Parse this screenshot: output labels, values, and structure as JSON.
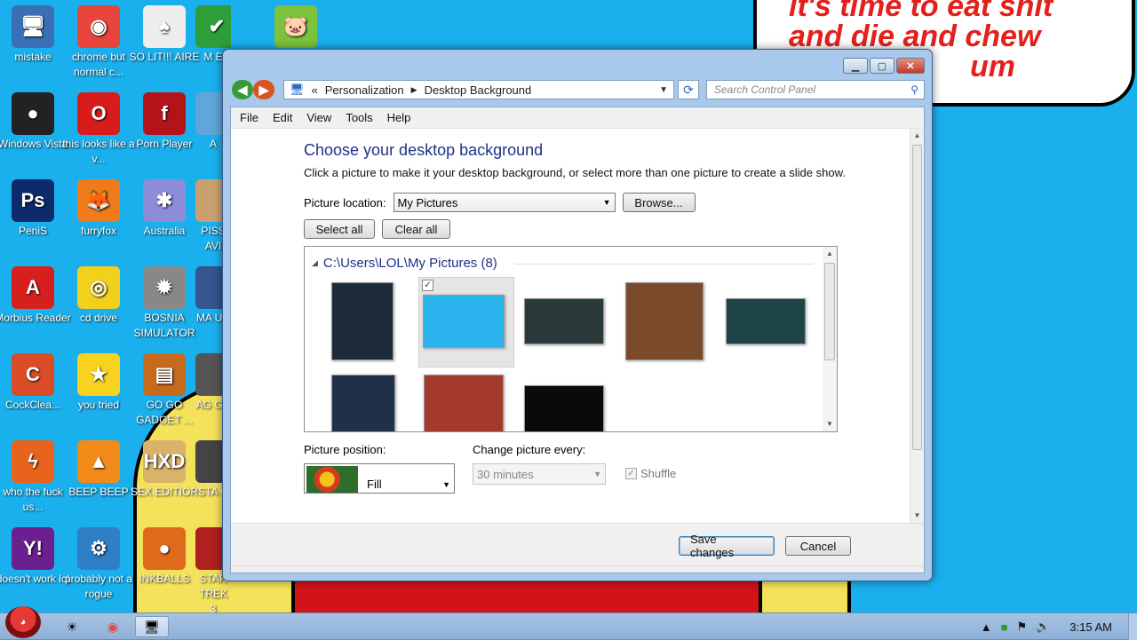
{
  "wallpaper": {
    "bubble_lines": [
      "it's time to eat shit",
      "and die and chew",
      "um"
    ]
  },
  "desktop_icons": [
    {
      "label": "mistake",
      "glyph": "🖥",
      "color": "#3b6fb5"
    },
    {
      "label": "chrome but normal c...",
      "glyph": "◉",
      "color": "#e8453c"
    },
    {
      "label": "SO LIT!!! AIRE",
      "glyph": "♠",
      "color": "#eeeeee"
    },
    {
      "label": "M E",
      "glyph": "✔",
      "color": "#2e9e3a"
    },
    {
      "label": "",
      "glyph": "🐷",
      "color": "#7cc23d"
    },
    {
      "label": "Windows Vista",
      "glyph": "●",
      "color": "#222222"
    },
    {
      "label": "this looks like a v...",
      "glyph": "O",
      "color": "#d81c1c"
    },
    {
      "label": "Porn Player",
      "glyph": "f",
      "color": "#b3141a"
    },
    {
      "label": "A",
      "glyph": "",
      "color": "#5fa6d9"
    },
    {
      "label": "PeniS",
      "glyph": "Ps",
      "color": "#0b2b6b"
    },
    {
      "label": "furryfox",
      "glyph": "🦊",
      "color": "#f07b1a"
    },
    {
      "label": "Australia",
      "glyph": "✱",
      "color": "#8c8cd8"
    },
    {
      "label": "PISS AVI",
      "glyph": "",
      "color": "#c9a070"
    },
    {
      "label": "Morbius Reader",
      "glyph": "A",
      "color": "#d6201d"
    },
    {
      "label": "cd drive",
      "glyph": "◎",
      "color": "#f2d11c"
    },
    {
      "label": "BOSNIA SIMULATOR",
      "glyph": "✹",
      "color": "#888888"
    },
    {
      "label": "MA UN",
      "glyph": "",
      "color": "#34558f"
    },
    {
      "label": "CockClea...",
      "glyph": "C",
      "color": "#d94c26"
    },
    {
      "label": "you tried",
      "glyph": "★",
      "color": "#f7d21e"
    },
    {
      "label": "GO GO GADGET ...",
      "glyph": "▤",
      "color": "#c66a1c"
    },
    {
      "label": "AG GH",
      "glyph": "",
      "color": "#555555"
    },
    {
      "label": "who the fuck us...",
      "glyph": "ϟ",
      "color": "#e8641c"
    },
    {
      "label": "BEEP BEEP",
      "glyph": "▲",
      "color": "#f28a1a"
    },
    {
      "label": "SEX EDITIOR",
      "glyph": "HXD",
      "color": "#d9b36a"
    },
    {
      "label": "STA C",
      "glyph": "",
      "color": "#444444"
    },
    {
      "label": "doesn't work lol",
      "glyph": "Y!",
      "color": "#6c1f8f"
    },
    {
      "label": "probably not a rogue",
      "glyph": "⚙",
      "color": "#2f7fc6"
    },
    {
      "label": "INKBALLS",
      "glyph": "●",
      "color": "#e06a1c"
    },
    {
      "label": "STAR TREK 3",
      "glyph": "",
      "color": "#b02020"
    }
  ],
  "window": {
    "breadcrumb_prefix": "«",
    "breadcrumb": [
      "Personalization",
      "Desktop Background"
    ],
    "search_placeholder": "Search Control Panel",
    "menu": [
      "File",
      "Edit",
      "View",
      "Tools",
      "Help"
    ],
    "heading": "Choose your desktop background",
    "description": "Click a picture to make it your desktop background, or select more than one picture to create a slide show.",
    "picture_location_label": "Picture location:",
    "picture_location_value": "My Pictures",
    "browse_label": "Browse...",
    "select_all_label": "Select all",
    "clear_all_label": "Clear all",
    "gallery_header": "C:\\Users\\LOL\\My Pictures (8)",
    "thumbnails": [
      {
        "name": "morbius-poster",
        "color": "#1d2b3a",
        "selected": false
      },
      {
        "name": "cartoon-chef",
        "color": "#2bb3ee",
        "selected": true
      },
      {
        "name": "morbius-dark-face",
        "color": "#2a3a3a",
        "selected": false
      },
      {
        "name": "jesus-painting",
        "color": "#7a4a2a",
        "selected": false
      },
      {
        "name": "morbius-teal",
        "color": "#1e4448",
        "selected": false
      },
      {
        "name": "morbius-poster-2",
        "color": "#203048",
        "selected": false
      },
      {
        "name": "santa",
        "color": "#a33a2a",
        "selected": false
      },
      {
        "name": "how-high",
        "color": "#0a0a0a",
        "selected": false
      }
    ],
    "picture_position_label": "Picture position:",
    "picture_position_value": "Fill",
    "change_every_label": "Change picture every:",
    "change_every_value": "30 minutes",
    "shuffle_label": "Shuffle",
    "save_label": "Save changes",
    "cancel_label": "Cancel"
  },
  "taskbar": {
    "clock": "3:15 AM"
  }
}
